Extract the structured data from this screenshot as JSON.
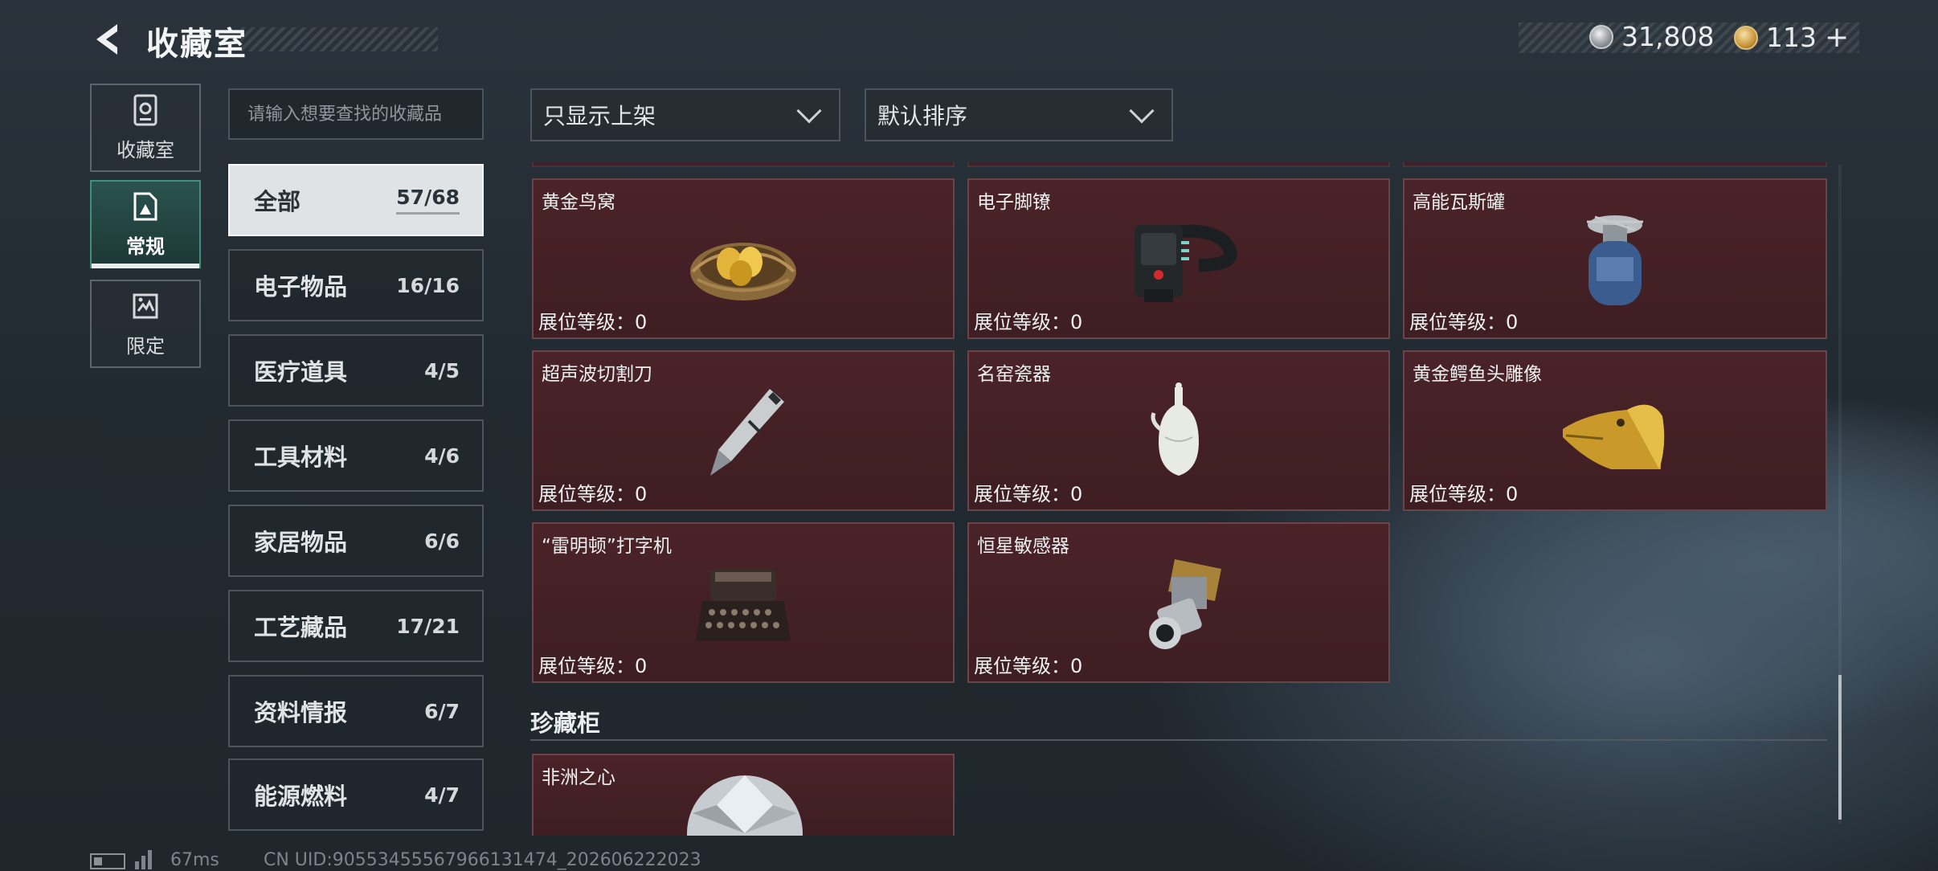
{
  "header": {
    "back_icon": "back-arrow-icon",
    "title": "收藏室",
    "currency": [
      {
        "icon": "silver-coin-icon",
        "value": "31,808",
        "color": "#b8bec2"
      },
      {
        "icon": "gold-coin-icon",
        "value": "113",
        "color": "#d9a94a",
        "plus": "+"
      }
    ]
  },
  "nav": {
    "tabs": [
      {
        "label": "收藏室",
        "icon": "collection-room-icon",
        "active": false
      },
      {
        "label": "常规",
        "icon": "regular-icon",
        "active": true
      },
      {
        "label": "限定",
        "icon": "limited-icon",
        "active": false
      }
    ]
  },
  "search": {
    "placeholder": "请输入想要查找的收藏品"
  },
  "filters": {
    "shelf_filter": "只显示上架",
    "sort": "默认排序"
  },
  "categories": [
    {
      "name": "全部",
      "count": "57/68",
      "active": true
    },
    {
      "name": "电子物品",
      "count": "16/16"
    },
    {
      "name": "医疗道具",
      "count": "4/5"
    },
    {
      "name": "工具材料",
      "count": "4/6"
    },
    {
      "name": "家居物品",
      "count": "6/6"
    },
    {
      "name": "工艺藏品",
      "count": "17/21"
    },
    {
      "name": "资料情报",
      "count": "6/7"
    },
    {
      "name": "能源燃料",
      "count": "4/7"
    }
  ],
  "items": [
    {
      "name": "黄金鸟窝",
      "level": "展位等级：0",
      "icon": "golden-nest-icon"
    },
    {
      "name": "电子脚镣",
      "level": "展位等级：0",
      "icon": "electronic-ankle-monitor-icon"
    },
    {
      "name": "高能瓦斯罐",
      "level": "展位等级：0",
      "icon": "gas-canister-icon"
    },
    {
      "name": "超声波切割刀",
      "level": "展位等级：0",
      "icon": "ultrasonic-cutter-icon"
    },
    {
      "name": "名窑瓷器",
      "level": "展位等级：0",
      "icon": "porcelain-vase-icon"
    },
    {
      "name": "黄金鳄鱼头雕像",
      "level": "展位等级：0",
      "icon": "golden-crocodile-statue-icon"
    },
    {
      "name": "“雷明顿”打字机",
      "level": "展位等级：0",
      "icon": "typewriter-icon"
    },
    {
      "name": "恒星敏感器",
      "level": "展位等级：0",
      "icon": "star-sensor-icon"
    }
  ],
  "treasure_section": {
    "title": "珍藏柜",
    "items": [
      {
        "name": "非洲之心",
        "icon": "diamond-icon"
      }
    ]
  },
  "footer": {
    "ping": "67ms",
    "uid": "CN UID:90553455567966131474_202606222023"
  }
}
